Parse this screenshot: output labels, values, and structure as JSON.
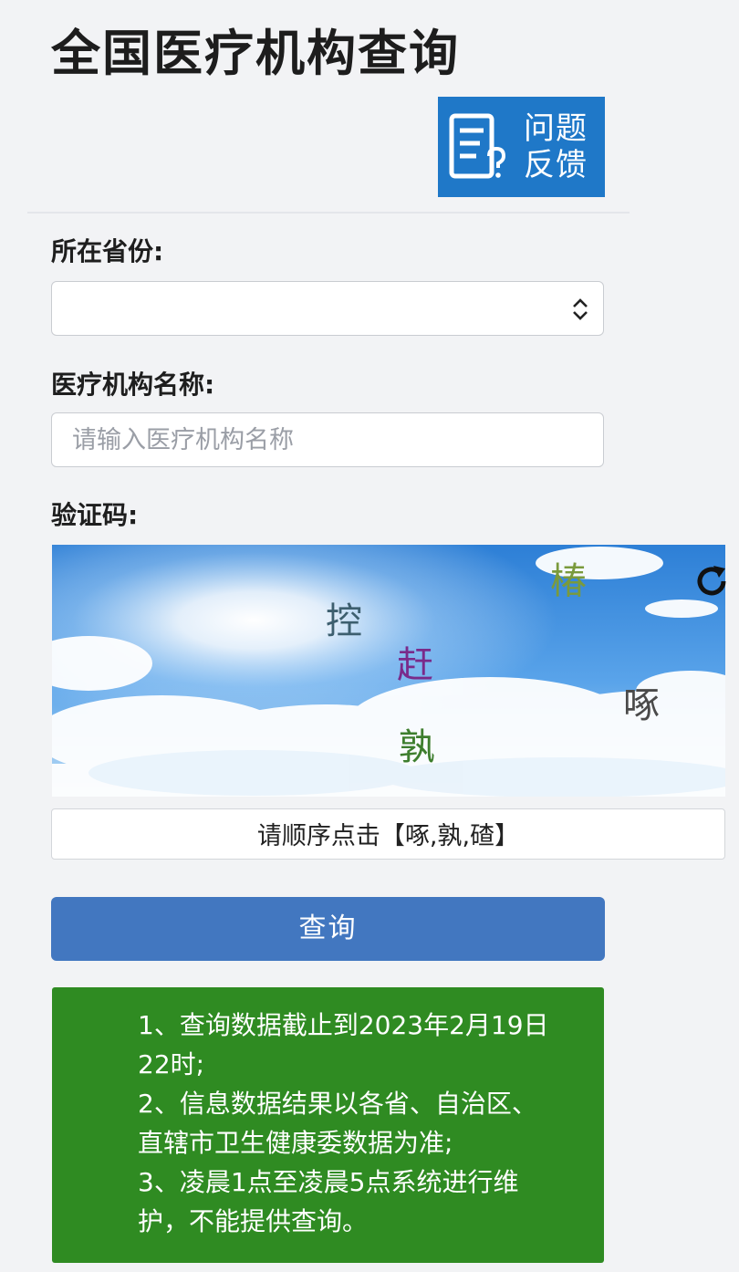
{
  "header": {
    "title": "全国医疗机构查询",
    "feedback_label_line1": "问题",
    "feedback_label_line2": "反馈"
  },
  "form": {
    "province_label": "所在省份:",
    "province_selected": "",
    "institution_label": "医疗机构名称:",
    "institution_placeholder": "请输入医疗机构名称",
    "institution_value": "",
    "captcha_label": "验证码:",
    "captcha_chars": [
      "椿",
      "控",
      "赶",
      "啄",
      "孰"
    ],
    "captcha_prompt": "请顺序点击【啄,孰,碴】",
    "submit_label": "查询"
  },
  "notice": {
    "lines": [
      "1、查询数据截止到2023年2月19日",
      "22时;",
      "2、信息数据结果以各省、自治区、",
      "直辖市卫生健康委数据为准;",
      "3、凌晨1点至凌晨5点系统进行维",
      "护，不能提供查询。"
    ]
  },
  "colors": {
    "feedback_bg": "#1f78c8",
    "submit_bg": "#4277c0",
    "notice_bg": "#2f8b22",
    "page_bg": "#f2f3f5"
  }
}
